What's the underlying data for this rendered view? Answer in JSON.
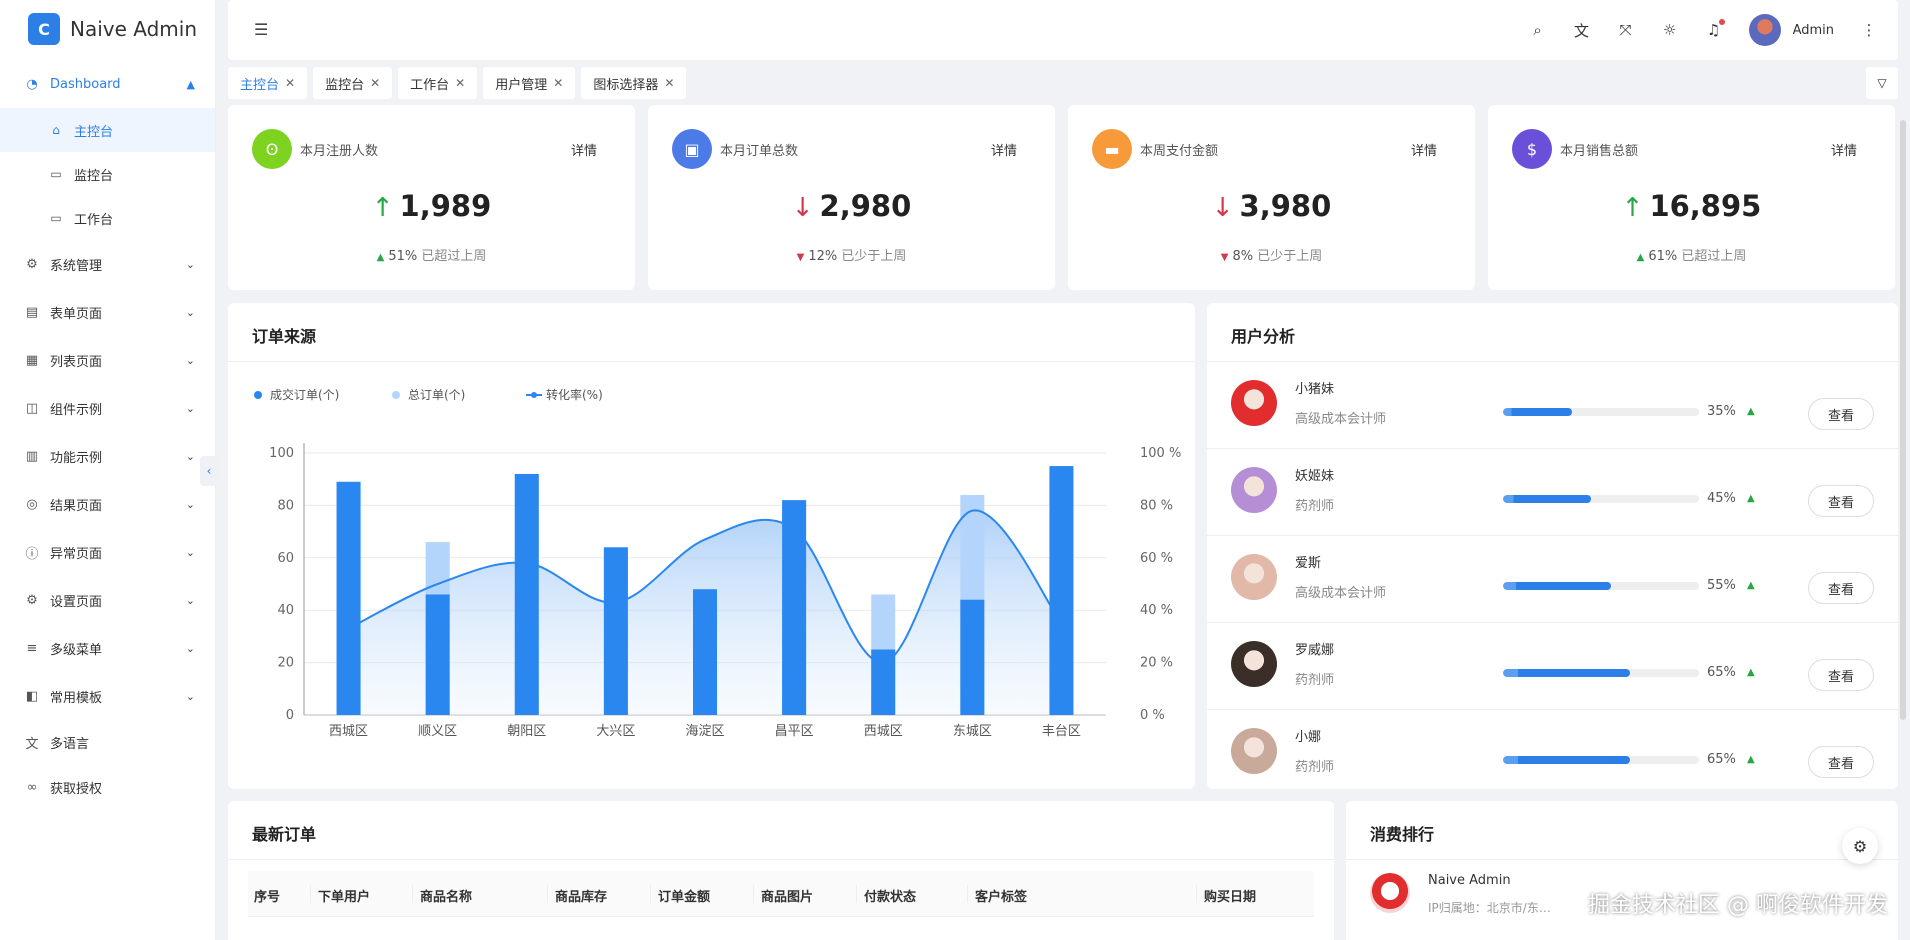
{
  "app": {
    "name": "Naive Admin",
    "logo_glyph": "C"
  },
  "sidebar": {
    "dashboard": {
      "label": "Dashboard",
      "icon": "dashboard-icon"
    },
    "sub_items": [
      {
        "label": "主控台",
        "icon": "home-icon",
        "active": true
      },
      {
        "label": "监控台",
        "icon": "monitor-check-icon"
      },
      {
        "label": "工作台",
        "icon": "desktop-icon"
      }
    ],
    "items": [
      {
        "label": "系统管理",
        "icon": "gear-icon"
      },
      {
        "label": "表单页面",
        "icon": "form-icon"
      },
      {
        "label": "列表页面",
        "icon": "table-icon"
      },
      {
        "label": "组件示例",
        "icon": "component-icon"
      },
      {
        "label": "功能示例",
        "icon": "function-icon"
      },
      {
        "label": "结果页面",
        "icon": "check-circle-icon"
      },
      {
        "label": "异常页面",
        "icon": "alert-circle-icon"
      },
      {
        "label": "设置页面",
        "icon": "settings-icon"
      },
      {
        "label": "多级菜单",
        "icon": "menu-icon"
      },
      {
        "label": "常用模板",
        "icon": "template-icon"
      }
    ],
    "plain": [
      {
        "label": "多语言",
        "icon": "translate-icon"
      },
      {
        "label": "获取授权",
        "icon": "link-icon"
      }
    ]
  },
  "header": {
    "user_name": "Admin"
  },
  "tabs": [
    {
      "label": "主控台",
      "active": true
    },
    {
      "label": "监控台"
    },
    {
      "label": "工作台"
    },
    {
      "label": "用户管理"
    },
    {
      "label": "图标选择器"
    }
  ],
  "stats": [
    {
      "title": "本月注册人数",
      "detail": "详情",
      "value": "1,989",
      "trend": "up",
      "pct": "51%",
      "compare": "已超过上周",
      "color": "#7ed321"
    },
    {
      "title": "本月订单总数",
      "detail": "详情",
      "value": "2,980",
      "trend": "down",
      "pct": "12%",
      "compare": "已少于上周",
      "color": "#4c7be8"
    },
    {
      "title": "本周支付金额",
      "detail": "详情",
      "value": "3,980",
      "trend": "down",
      "pct": "8%",
      "compare": "已少于上周",
      "color": "#f79a3a"
    },
    {
      "title": "本月销售总额",
      "detail": "详情",
      "value": "16,895",
      "trend": "up",
      "pct": "61%",
      "compare": "已超过上周",
      "color": "#6a4fd8"
    }
  ],
  "order_source": {
    "title": "订单来源"
  },
  "chart_data": {
    "type": "bar",
    "categories": [
      "西城区",
      "顺义区",
      "朝阳区",
      "大兴区",
      "海淀区",
      "昌平区",
      "西城区",
      "东城区",
      "丰台区"
    ],
    "series": [
      {
        "name": "成交订单(个)",
        "type": "bar",
        "values": [
          89,
          46,
          92,
          64,
          48,
          82,
          25,
          44,
          95
        ],
        "color": "#2a87f0"
      },
      {
        "name": "总订单(个)",
        "type": "bar",
        "values": [
          89,
          66,
          92,
          64,
          48,
          82,
          46,
          84,
          95
        ],
        "color": "#b3d4fb"
      },
      {
        "name": "转化率(%)",
        "type": "line",
        "axis": "right",
        "values": [
          33,
          50,
          58,
          43,
          67,
          71,
          20,
          78,
          35
        ],
        "color": "#2a87f0"
      }
    ],
    "ylim": [
      0,
      100
    ],
    "y_ticks": [
      "0",
      "20",
      "40",
      "60",
      "80",
      "100"
    ],
    "y2_ticks": [
      "0 %",
      "20 %",
      "40 %",
      "60 %",
      "80 %",
      "100 %"
    ],
    "legend": "top-left",
    "grid": true
  },
  "user_analysis": {
    "title": "用户分析",
    "btn_label": "查看",
    "users": [
      {
        "name": "小猪妹",
        "role": "高级成本会计师",
        "pct": "35%",
        "value": 0.35,
        "avatar": "#e12d2d"
      },
      {
        "name": "妖姬妹",
        "role": "药剂师",
        "pct": "45%",
        "value": 0.45,
        "avatar": "#b58fd6"
      },
      {
        "name": "爱斯",
        "role": "高级成本会计师",
        "pct": "55%",
        "value": 0.55,
        "avatar": "#e2b8a8"
      },
      {
        "name": "罗威娜",
        "role": "药剂师",
        "pct": "65%",
        "value": 0.65,
        "avatar": "#3a2f28"
      },
      {
        "name": "小娜",
        "role": "药剂师",
        "pct": "65%",
        "value": 0.65,
        "avatar": "#c9a99a"
      }
    ]
  },
  "latest_orders": {
    "title": "最新订单",
    "columns": [
      "序号",
      "下单用户",
      "商品名称",
      "商品库存",
      "订单金额",
      "商品图片",
      "付款状态",
      "客户标签",
      "购买日期"
    ]
  },
  "ranking": {
    "title": "消费排行",
    "name": "Naive Admin",
    "ip": "IP归属地：北京市/东…"
  },
  "watermark": "掘金技术社区 @ 啊俊软件开发"
}
